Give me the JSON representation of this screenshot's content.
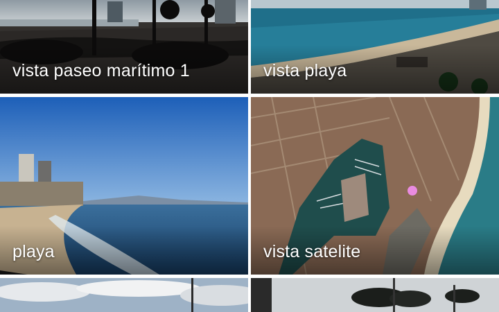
{
  "gallery": {
    "items": [
      {
        "label": "vista paseo marítimo 1",
        "thumbnail": "promenade-crowd-photo"
      },
      {
        "label": "vista playa",
        "thumbnail": "beach-aerial-photo"
      },
      {
        "label": "playa",
        "thumbnail": "beach-towers-photo"
      },
      {
        "label": "vista satelite",
        "thumbnail": "satellite-marina-photo"
      },
      {
        "label": "",
        "thumbnail": "cloudy-sky-photo"
      },
      {
        "label": "",
        "thumbnail": "palm-trees-photo"
      }
    ]
  }
}
